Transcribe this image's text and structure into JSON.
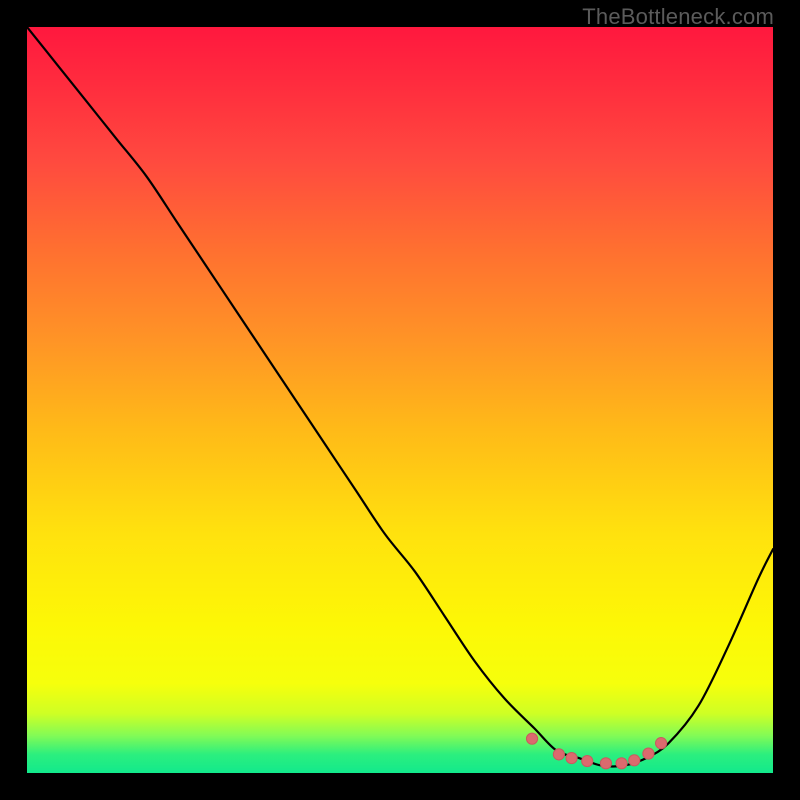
{
  "watermark": {
    "text": "TheBottleneck.com"
  },
  "colors": {
    "curve": "#000000",
    "dot_fill": "#db6a6e",
    "dot_stroke": "#c85b5f",
    "frame": "#000000"
  },
  "chart_data": {
    "type": "line",
    "title": "",
    "xlabel": "",
    "ylabel": "",
    "xlim": [
      0,
      100
    ],
    "ylim": [
      0,
      100
    ],
    "grid": false,
    "legend": false,
    "background": "red-yellow-green vertical gradient (bottleneck heatmap style)",
    "series": [
      {
        "name": "bottleneck-curve",
        "x": [
          0,
          4,
          8,
          12,
          16,
          20,
          24,
          28,
          32,
          36,
          40,
          44,
          48,
          52,
          56,
          60,
          64,
          68,
          71,
          74,
          77,
          80,
          83,
          86,
          90,
          94,
          98,
          100
        ],
        "y": [
          100,
          95,
          90,
          85,
          80,
          74,
          68,
          62,
          56,
          50,
          44,
          38,
          32,
          27,
          21,
          15,
          10,
          6,
          3,
          2,
          1,
          1,
          2,
          4,
          9,
          17,
          26,
          30
        ]
      }
    ],
    "markers": {
      "name": "optimum-range-dots",
      "x": [
        67.7,
        71.3,
        73.0,
        75.1,
        77.6,
        79.7,
        81.4,
        83.3,
        85.0
      ],
      "y": [
        4.6,
        2.5,
        2.0,
        1.6,
        1.3,
        1.3,
        1.7,
        2.6,
        4.0
      ]
    },
    "annotations": []
  }
}
